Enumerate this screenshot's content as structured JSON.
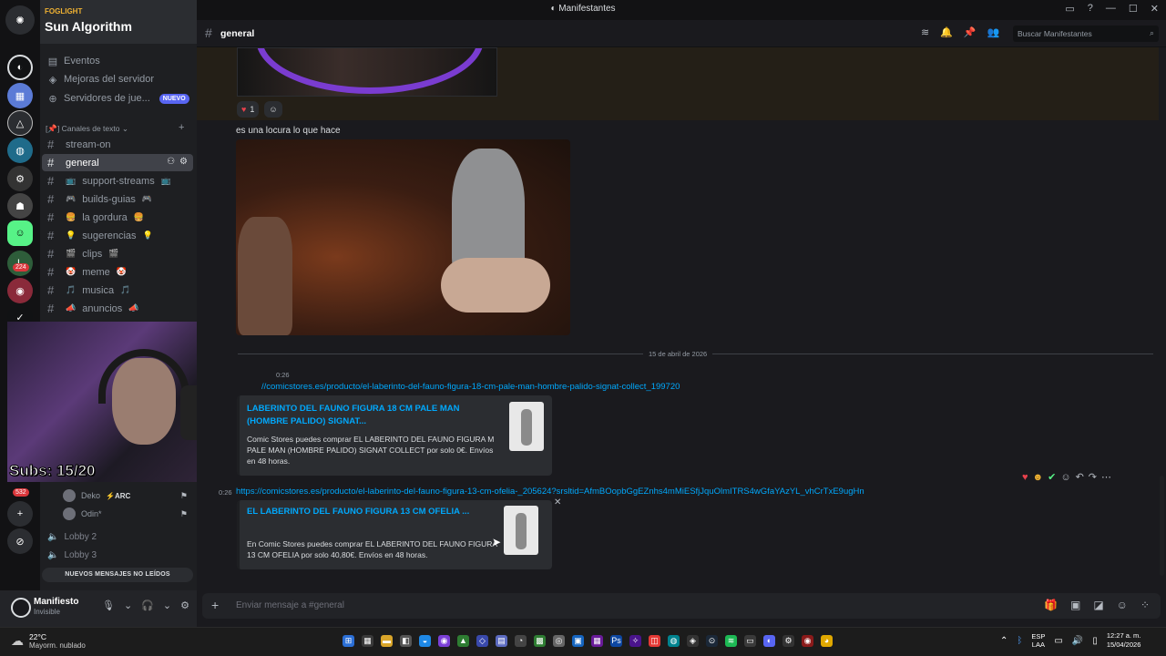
{
  "window": {
    "title": "Manifestantes"
  },
  "guild": {
    "sub_label": "FOGLIGHT",
    "name": "Sun Algorithm"
  },
  "sidebar": {
    "top_items": [
      {
        "label": "Eventos",
        "icon": "calendar-icon"
      },
      {
        "label": "Mejoras del servidor",
        "icon": "boost-icon"
      },
      {
        "label": "Servidores de jue...",
        "icon": "gamepad-icon",
        "badge": "NUEVO"
      }
    ],
    "category": "[📌] Canales de texto ⌄",
    "channels": [
      {
        "name": "stream-on",
        "emoji": "",
        "emoji2": ""
      },
      {
        "name": "general",
        "emoji": "",
        "emoji2": "",
        "active": true
      },
      {
        "name": "support-streams",
        "emoji": "📺",
        "emoji2": "📺"
      },
      {
        "name": "builds-guias",
        "emoji": "🎮",
        "emoji2": "🎮"
      },
      {
        "name": "la gordura",
        "emoji": "🍔",
        "emoji2": "🍔"
      },
      {
        "name": "sugerencias",
        "emoji": "💡",
        "emoji2": "💡"
      },
      {
        "name": "clips",
        "emoji": "🎬",
        "emoji2": "🎬"
      },
      {
        "name": "meme",
        "emoji": "🤡",
        "emoji2": "🤡"
      },
      {
        "name": "musica",
        "emoji": "🎵",
        "emoji2": "🎵"
      },
      {
        "name": "anuncios",
        "emoji": "📣",
        "emoji2": "📣"
      }
    ],
    "voice_users": [
      {
        "name": "Deko",
        "tag": "⚡ARC"
      },
      {
        "name": "Odin*",
        "tag": ""
      }
    ],
    "lobbies": [
      "Lobby 2",
      "Lobby 3"
    ],
    "new_messages": "NUEVOS MENSAJES NO LEÍDOS"
  },
  "server_rail": {
    "badges": [
      "224",
      "532"
    ]
  },
  "overlay": {
    "subs": "Subs: 15/20"
  },
  "user_panel": {
    "name": "Manifiesto",
    "status": "Invisible"
  },
  "header": {
    "channel": "general",
    "search_placeholder": "Buscar Manifestantes"
  },
  "messages": {
    "reaction_count": "1",
    "text1": "es una locura lo que hace",
    "date_divider": "15 de abril de 2026",
    "msg1": {
      "time": "0:26",
      "link": "//comicstores.es/producto/el-laberinto-del-fauno-figura-18-cm-pale-man-hombre-palido-signat-collect_199720",
      "embed_title": "LABERINTO DEL FAUNO FIGURA 18 CM PALE MAN (HOMBRE PALIDO) SIGNAT...",
      "embed_desc": "Comic Stores puedes comprar EL LABERINTO DEL FAUNO FIGURA M PALE MAN (HOMBRE PALIDO) SIGNAT COLLECT por solo 0€. Envíos en 48 horas."
    },
    "msg2": {
      "time": "0:26",
      "link": "https://comicstores.es/producto/el-laberinto-del-fauno-figura-13-cm-ofelia-_205624?srsltid=AfmBOopbGgEZnhs4mMiESfjJquOlmITRS4wGfaYAzYL_vhCrTxE9ugHn",
      "embed_title": "EL LABERINTO DEL FAUNO FIGURA 13 CM OFELIA ...",
      "embed_desc": "En Comic Stores puedes comprar EL LABERINTO DEL FAUNO FIGURA 13 CM OFELIA por solo 40,80€. Envíos en 48 horas."
    }
  },
  "composer": {
    "placeholder": "Enviar mensaje a #general"
  },
  "taskbar": {
    "temp": "22°C",
    "condition": "Mayorm. nublado",
    "lang1": "ESP",
    "lang2": "LAA",
    "time": "12:27 a. m.",
    "date": "15/04/2026"
  }
}
